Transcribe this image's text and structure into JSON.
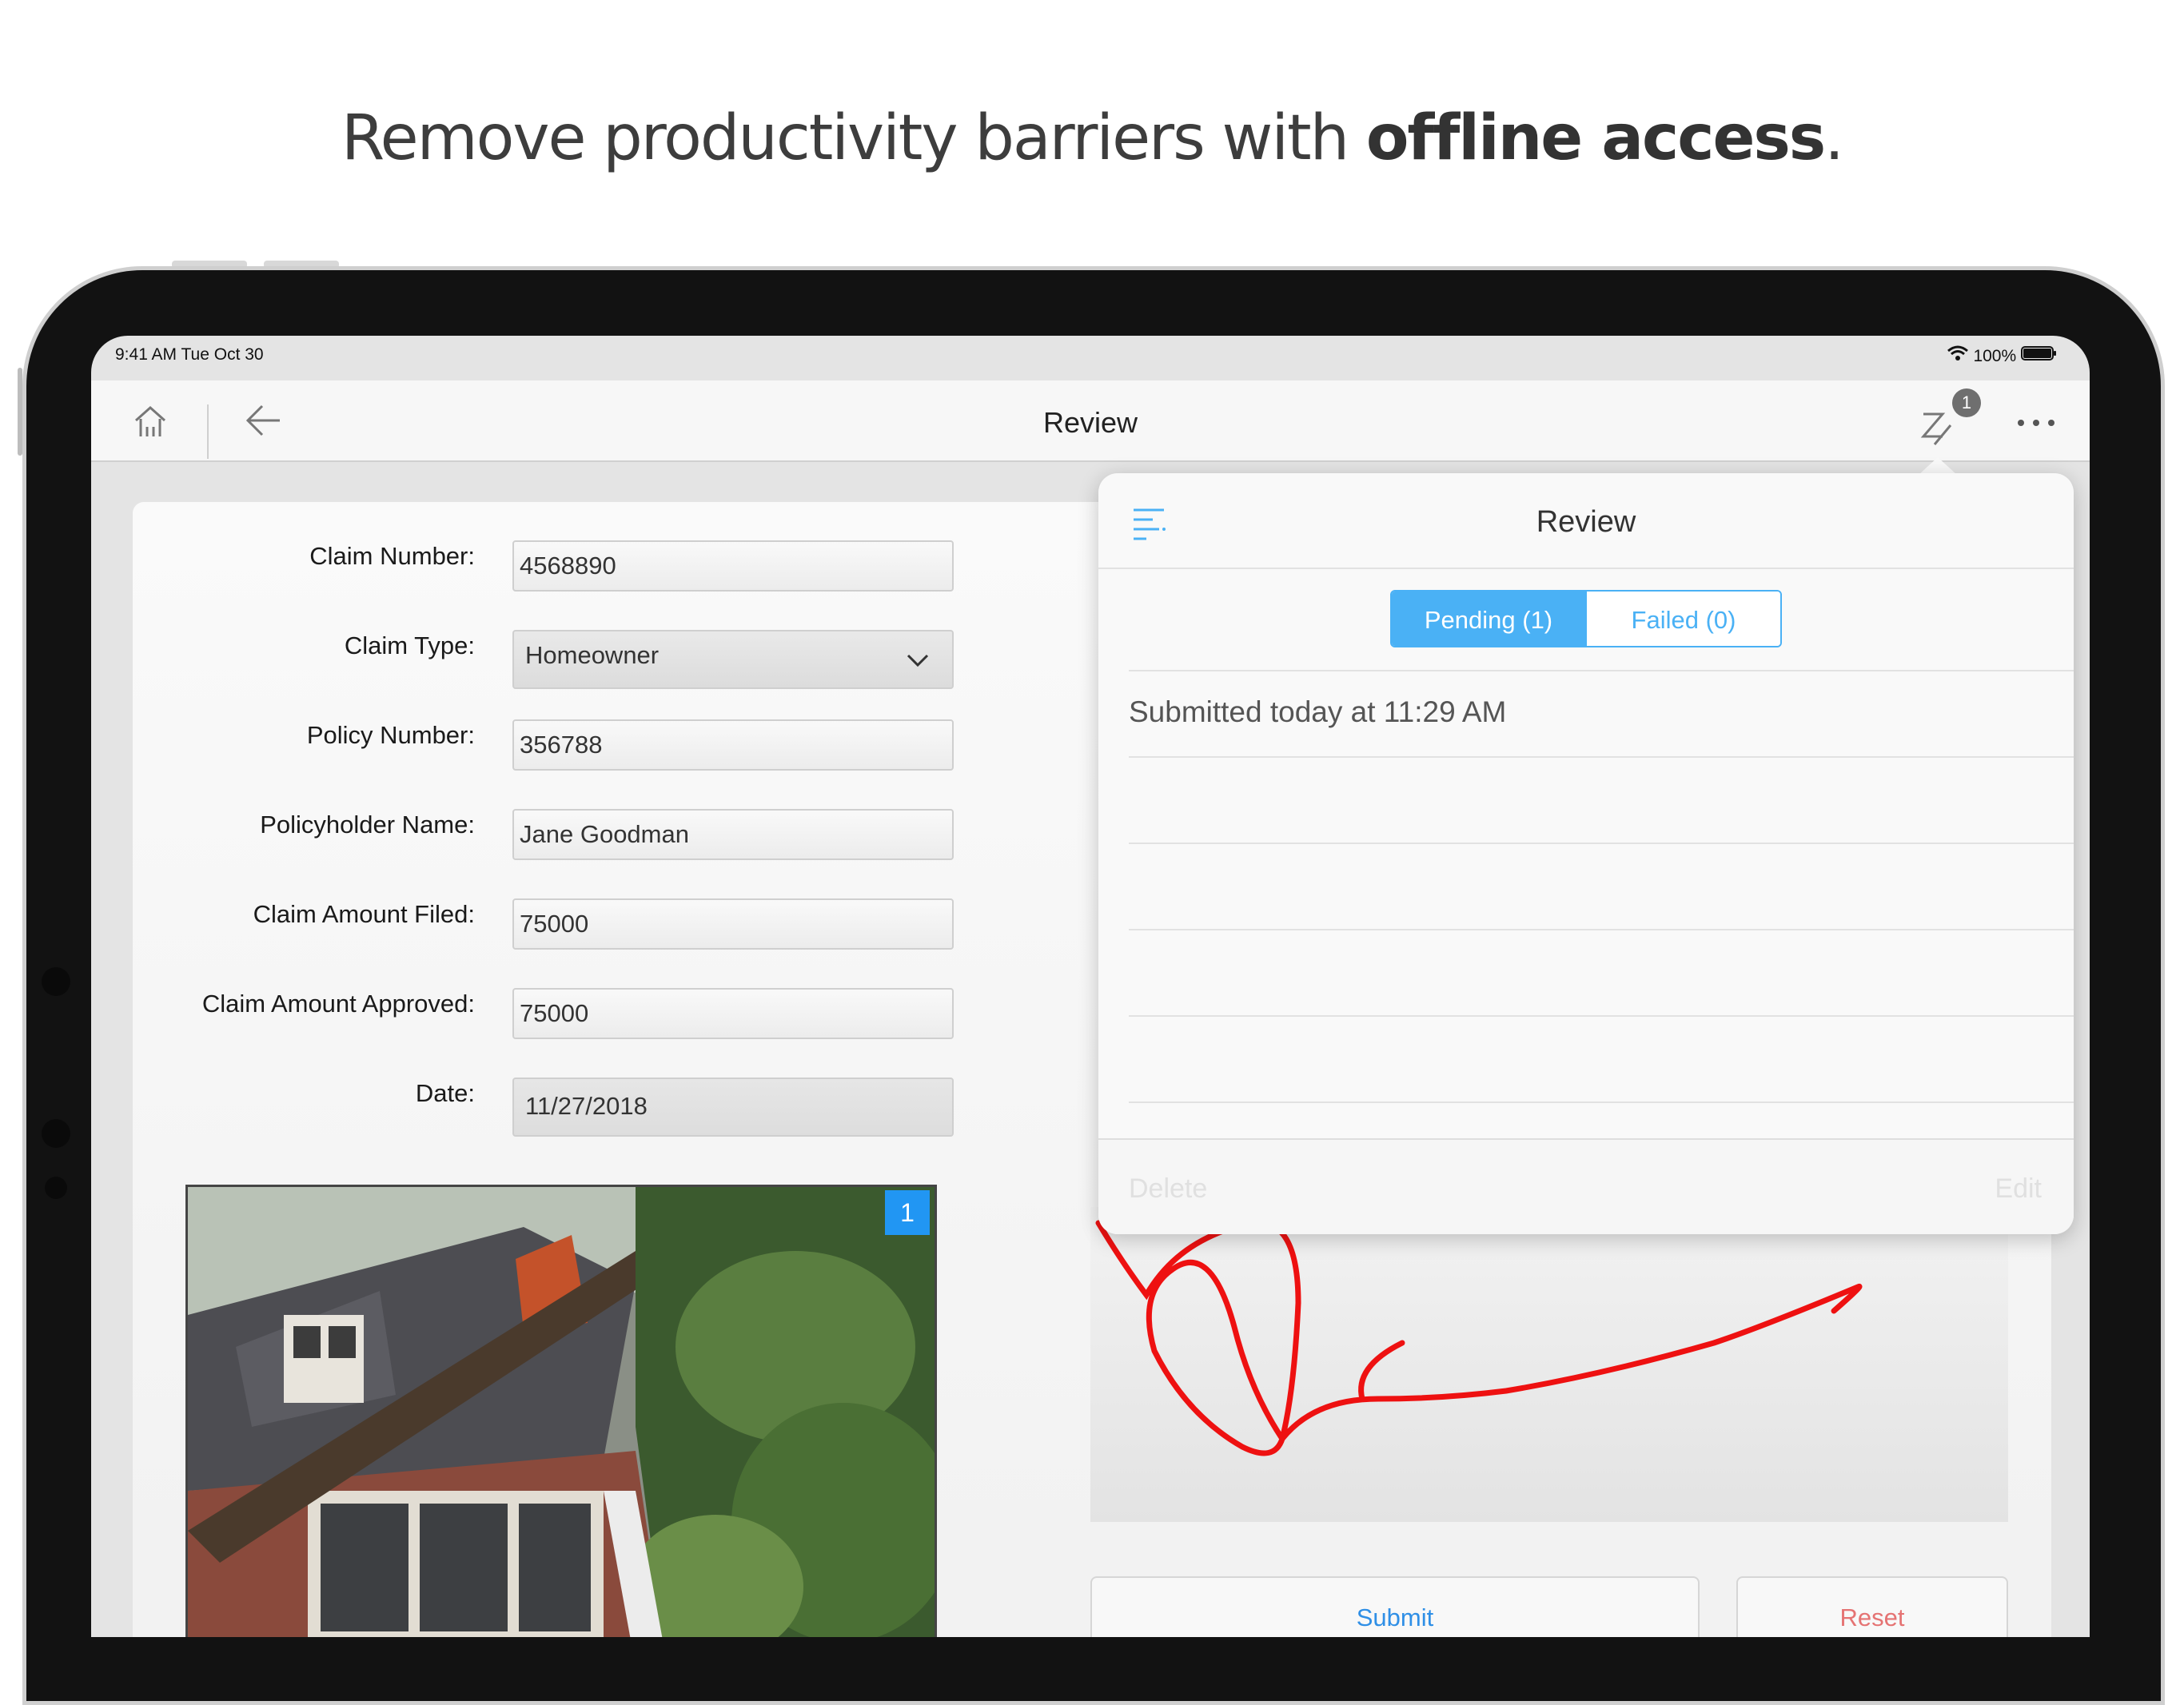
{
  "headline": {
    "regular": "Remove productivity barriers with ",
    "bold": "offline access",
    "tail": "."
  },
  "status_bar": {
    "time": "9:41 AM   Tue Oct 30",
    "battery": "100%"
  },
  "nav": {
    "title": "Review",
    "badge_count": "1"
  },
  "form": {
    "fields": [
      {
        "label": "Claim Number:",
        "value": "4568890"
      },
      {
        "label": "Claim Type:",
        "value": "Homeowner"
      },
      {
        "label": "Policy Number:",
        "value": "356788"
      },
      {
        "label": "Policyholder Name:",
        "value": "Jane Goodman"
      },
      {
        "label": "Claim Amount Filed:",
        "value": "75000"
      },
      {
        "label": "Claim Amount Approved:",
        "value": "75000"
      },
      {
        "label": "Date:",
        "value": "11/27/2018"
      }
    ],
    "photo_badge": "1",
    "submit_label": "Submit",
    "reset_label": "Reset"
  },
  "popover": {
    "title": "Review",
    "tabs": [
      {
        "label": "Pending (1)",
        "selected": true
      },
      {
        "label": "Failed (0)",
        "selected": false
      }
    ],
    "items": [
      "Submitted today at 11:29 AM"
    ],
    "delete_label": "Delete",
    "edit_label": "Edit"
  },
  "colors": {
    "accent": "#4ab1f5",
    "photo_badge": "#2196f3",
    "signature": "#ee1111",
    "reset": "#e57373"
  }
}
